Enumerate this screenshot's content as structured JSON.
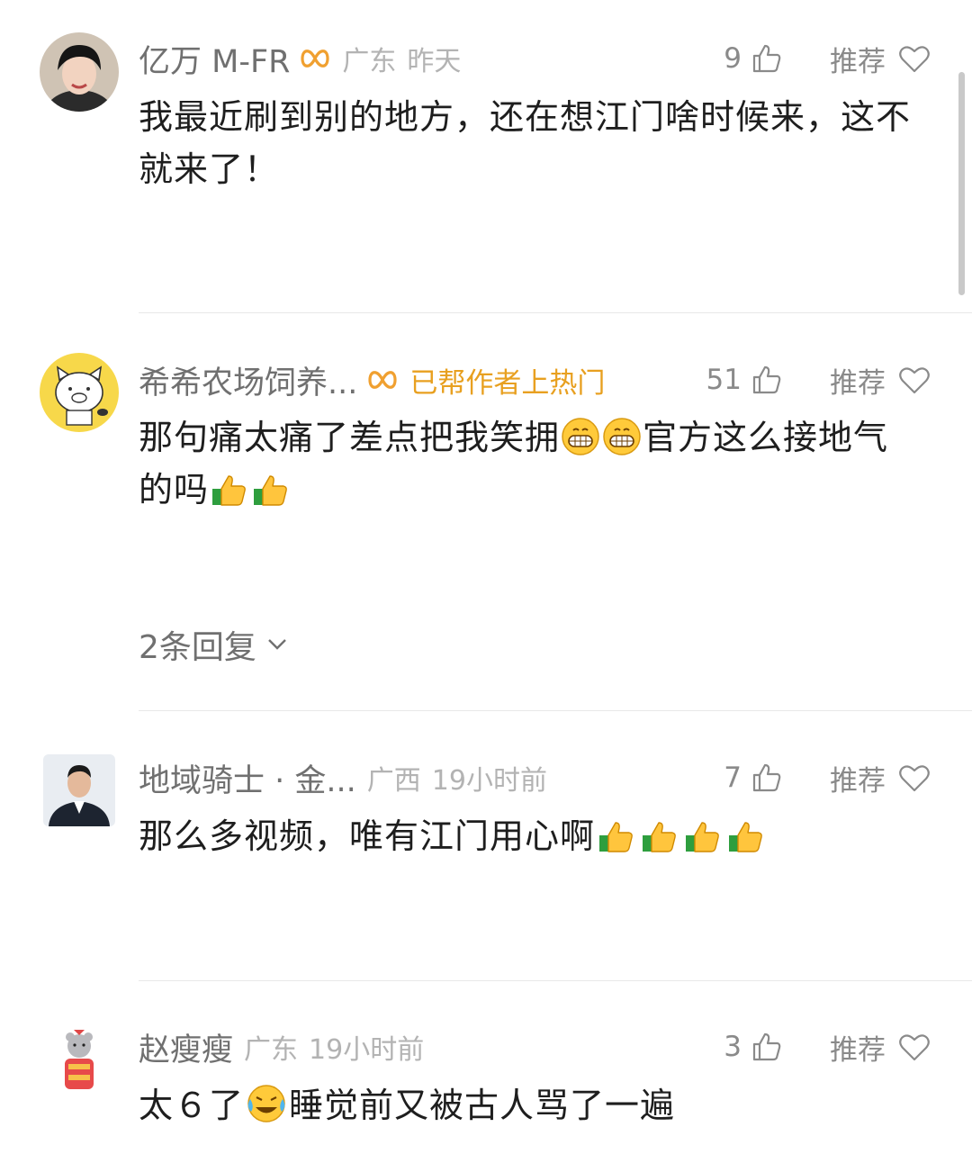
{
  "comments": [
    {
      "username": "亿万 M-FR",
      "location": "广东",
      "time": "昨天",
      "likes": "9",
      "recommend_label": "推荐",
      "text": "我最近刷到别的地方，还在想江门啥时候来，这不就来了！"
    },
    {
      "username": "希希农场饲养...",
      "hot_badge": "已帮作者上热门",
      "likes": "51",
      "recommend_label": "推荐",
      "text_part1": "那句痛太痛了差点把我笑拥",
      "text_part2": "官方这么接地气的吗",
      "replies_label": "2条回复"
    },
    {
      "username": "地域骑士 · 金...",
      "location": "广西",
      "time": "19小时前",
      "likes": "7",
      "recommend_label": "推荐",
      "text": "那么多视频，唯有江门用心啊"
    },
    {
      "username": "赵瘦瘦",
      "location": "广东",
      "time": "19小时前",
      "likes": "3",
      "recommend_label": "推荐",
      "text_part1": "太６了",
      "text_part2": "睡觉前又被古人骂了一遍"
    }
  ],
  "icons": {
    "like": "thumbs-up-outline-icon",
    "recommend": "heart-outline-icon",
    "badge": "infinity-badge-icon",
    "grin": "grinning-emoji-icon",
    "thumbs": "thumbs-up-emoji-icon",
    "cry": "crying-laughing-emoji-icon",
    "expand": "chevron-down-icon"
  },
  "colors": {
    "badge": "#f0a030",
    "hot_text": "#e8a020",
    "username": "#707070",
    "meta": "#b3b3b3"
  }
}
